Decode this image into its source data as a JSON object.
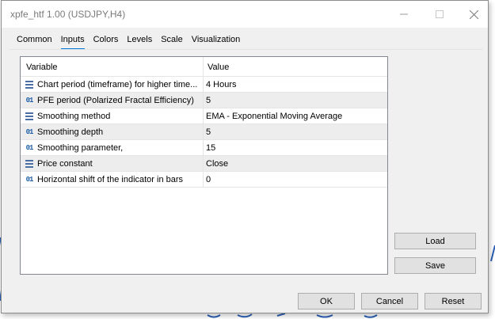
{
  "window": {
    "title": "xpfe_htf 1.00 (USDJPY,H4)"
  },
  "tabs": [
    {
      "label": "Common",
      "active": false
    },
    {
      "label": "Inputs",
      "active": true
    },
    {
      "label": "Colors",
      "active": false
    },
    {
      "label": "Levels",
      "active": false
    },
    {
      "label": "Scale",
      "active": false
    },
    {
      "label": "Visualization",
      "active": false
    }
  ],
  "table": {
    "headers": {
      "variable": "Variable",
      "value": "Value"
    },
    "rows": [
      {
        "icon": "enum-icon",
        "variable": "Chart period (timeframe) for higher time...",
        "value": "4 Hours"
      },
      {
        "icon": "number-icon",
        "variable": "PFE period (Polarized Fractal Efficiency)",
        "value": "5"
      },
      {
        "icon": "enum-icon",
        "variable": "Smoothing method",
        "value": "EMA - Exponential Moving Average"
      },
      {
        "icon": "number-icon",
        "variable": "Smoothing depth",
        "value": "5"
      },
      {
        "icon": "number-icon",
        "variable": "Smoothing parameter,",
        "value": "15"
      },
      {
        "icon": "enum-icon",
        "variable": "Price constant",
        "value": "Close"
      },
      {
        "icon": "number-icon",
        "variable": "Horizontal shift of the indicator in bars",
        "value": "0"
      }
    ]
  },
  "buttons": {
    "load": "Load",
    "save": "Save",
    "ok": "OK",
    "cancel": "Cancel",
    "reset": "Reset"
  },
  "icons": {
    "number_glyph": "01"
  },
  "colors": {
    "accent": "#0078d7",
    "chart_line": "#2b5fb4"
  }
}
